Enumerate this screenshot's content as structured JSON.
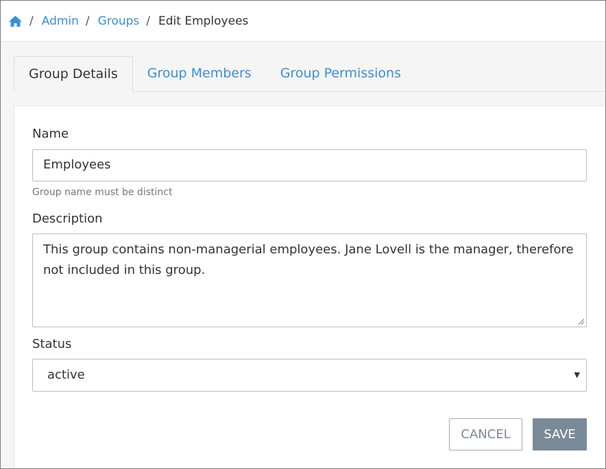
{
  "breadcrumb": {
    "home_icon": "home-icon",
    "items": [
      "Admin",
      "Groups"
    ],
    "current": "Edit Employees",
    "separator": "/"
  },
  "tabs": [
    {
      "label": "Group Details",
      "active": true
    },
    {
      "label": "Group Members",
      "active": false
    },
    {
      "label": "Group Permissions",
      "active": false
    }
  ],
  "form": {
    "name": {
      "label": "Name",
      "value": "Employees",
      "help": "Group name must be distinct"
    },
    "description": {
      "label": "Description",
      "value": "This group contains non-managerial employees. Jane Lovell is the manager, therefore not included in this group."
    },
    "status": {
      "label": "Status",
      "value": "active"
    }
  },
  "buttons": {
    "cancel": "CANCEL",
    "save": "SAVE"
  },
  "colors": {
    "link": "#3b8fd9",
    "save_button": "#7b8a98"
  }
}
